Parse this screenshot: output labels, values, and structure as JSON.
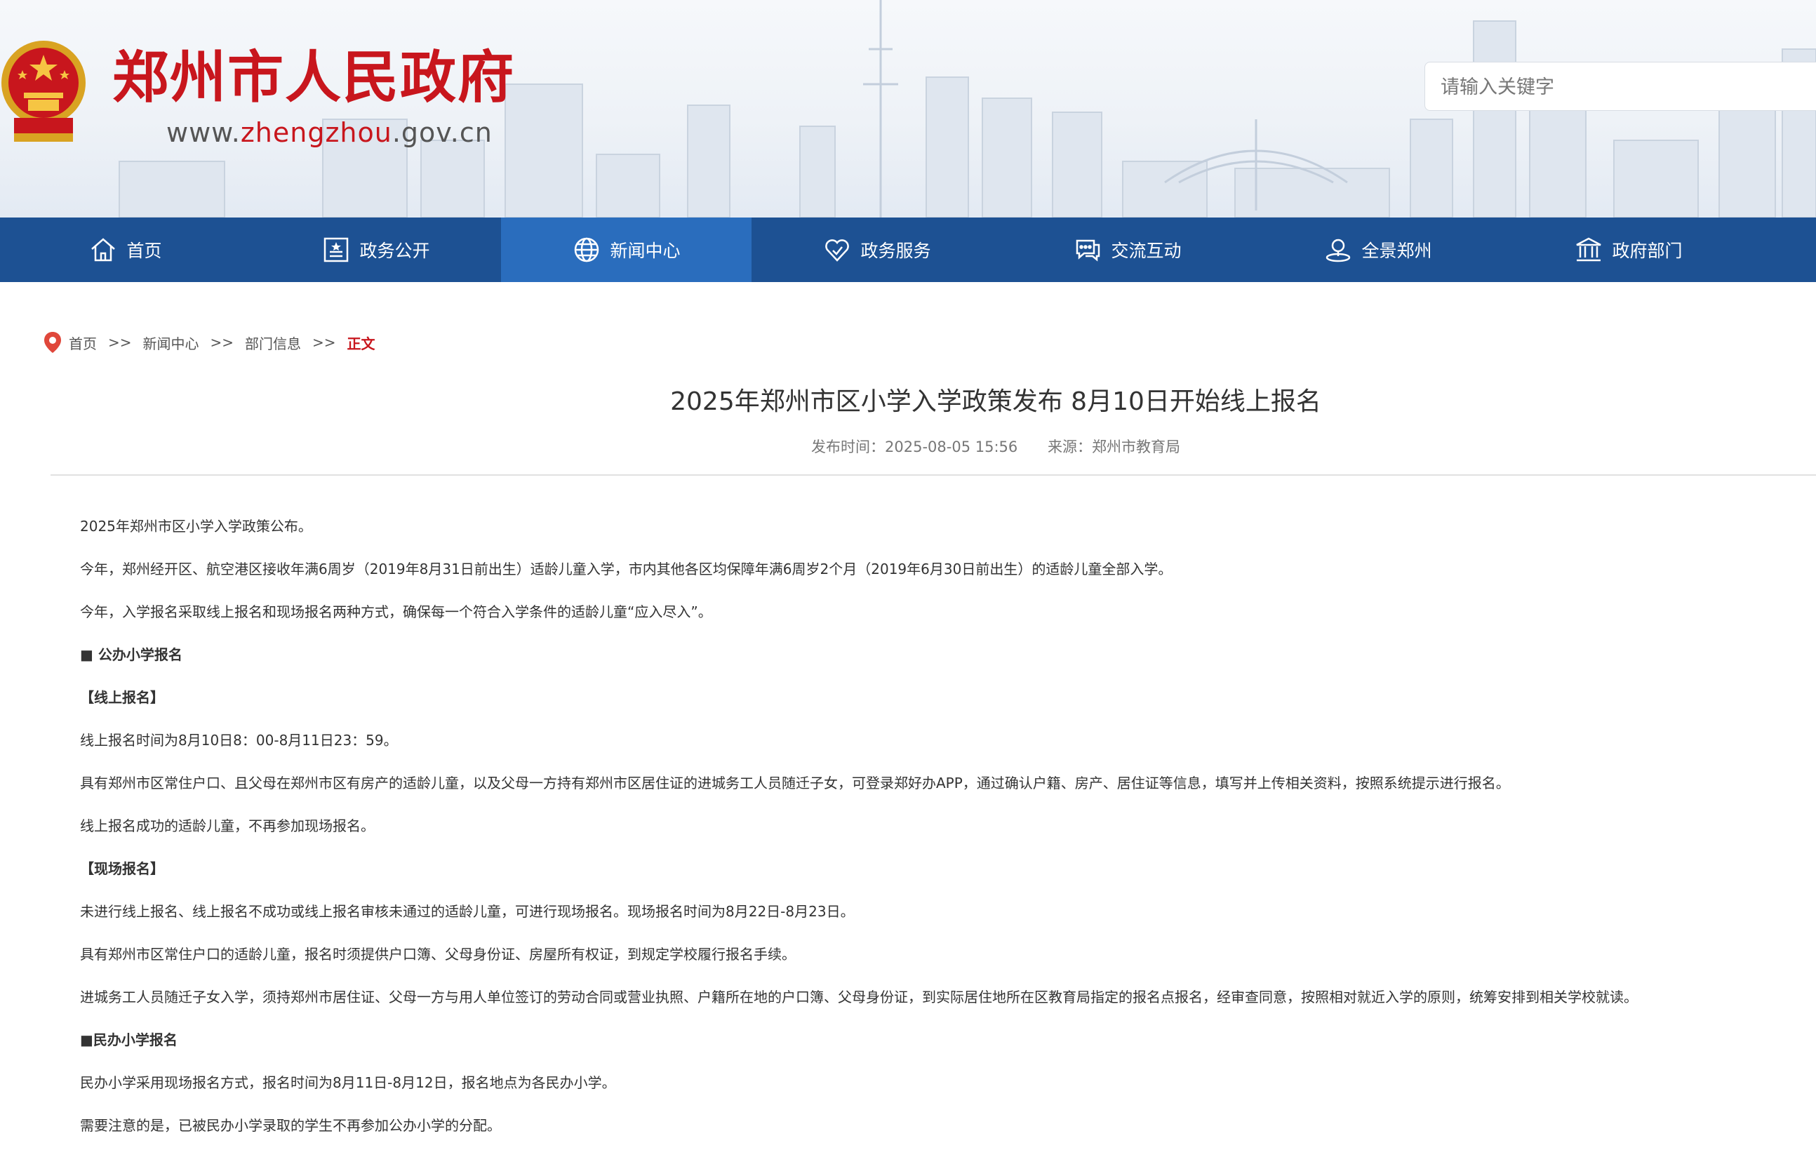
{
  "header": {
    "title": "郑州市人民政府",
    "url_prefix": "www.",
    "url_highlight": "zhengzhou",
    "url_suffix": ".gov.cn",
    "emblem_icon": "national-emblem-icon"
  },
  "search": {
    "placeholder": "请输入关键字"
  },
  "nav": {
    "items": [
      {
        "label": "首页",
        "icon": "home-icon"
      },
      {
        "label": "政务公开",
        "icon": "document-icon"
      },
      {
        "label": "新闻中心",
        "icon": "globe-icon"
      },
      {
        "label": "政务服务",
        "icon": "heart-icon"
      },
      {
        "label": "交流互动",
        "icon": "chat-icon"
      },
      {
        "label": "全景郑州",
        "icon": "panorama-icon"
      },
      {
        "label": "政府部门",
        "icon": "building-icon"
      }
    ],
    "active_index": 2
  },
  "breadcrumb": {
    "items": [
      "首页",
      "新闻中心",
      "部门信息"
    ],
    "separator": ">>",
    "current": "正文"
  },
  "article": {
    "title": "2025年郑州市区小学入学政策发布 8月10日开始线上报名",
    "publish_label": "发布时间：2025-08-05 15:56",
    "source_label": "来源：郑州市教育局",
    "paragraphs": [
      "2025年郑州市区小学入学政策公布。",
      "今年，郑州经开区、航空港区接收年满6周岁（2019年8月31日前出生）适龄儿童入学，市内其他各区均保障年满6周岁2个月（2019年6月30日前出生）的适龄儿童全部入学。",
      "今年，入学报名采取线上报名和现场报名两种方式，确保每一个符合入学条件的适龄儿童“应入尽入”。",
      "■ 公办小学报名",
      "【线上报名】",
      "线上报名时间为8月10日8：00-8月11日23：59。",
      "具有郑州市区常住户口、且父母在郑州市区有房产的适龄儿童，以及父母一方持有郑州市区居住证的进城务工人员随迁子女，可登录郑好办APP，通过确认户籍、房产、居住证等信息，填写并上传相关资料，按照系统提示进行报名。",
      "线上报名成功的适龄儿童，不再参加现场报名。",
      "【现场报名】",
      "未进行线上报名、线上报名不成功或线上报名审核未通过的适龄儿童，可进行现场报名。现场报名时间为8月22日-8月23日。",
      "具有郑州市区常住户口的适龄儿童，报名时须提供户口簿、父母身份证、房屋所有权证，到规定学校履行报名手续。",
      "进城务工人员随迁子女入学，须持郑州市居住证、父母一方与用人单位签订的劳动合同或营业执照、户籍所在地的户口簿、父母身份证，到实际居住地所在区教育局指定的报名点报名，经审查同意，按照相对就近入学的原则，统筹安排到相关学校就读。",
      "■民办小学报名",
      "民办小学采用现场报名方式，报名时间为8月11日-8月12日，报名地点为各民办小学。",
      "需要注意的是，已被民办小学录取的学生不再参加公办小学的分配。"
    ]
  },
  "colors": {
    "brand_red": "#c8161d",
    "nav_blue": "#1d5193",
    "nav_active": "#2a6dbd"
  }
}
